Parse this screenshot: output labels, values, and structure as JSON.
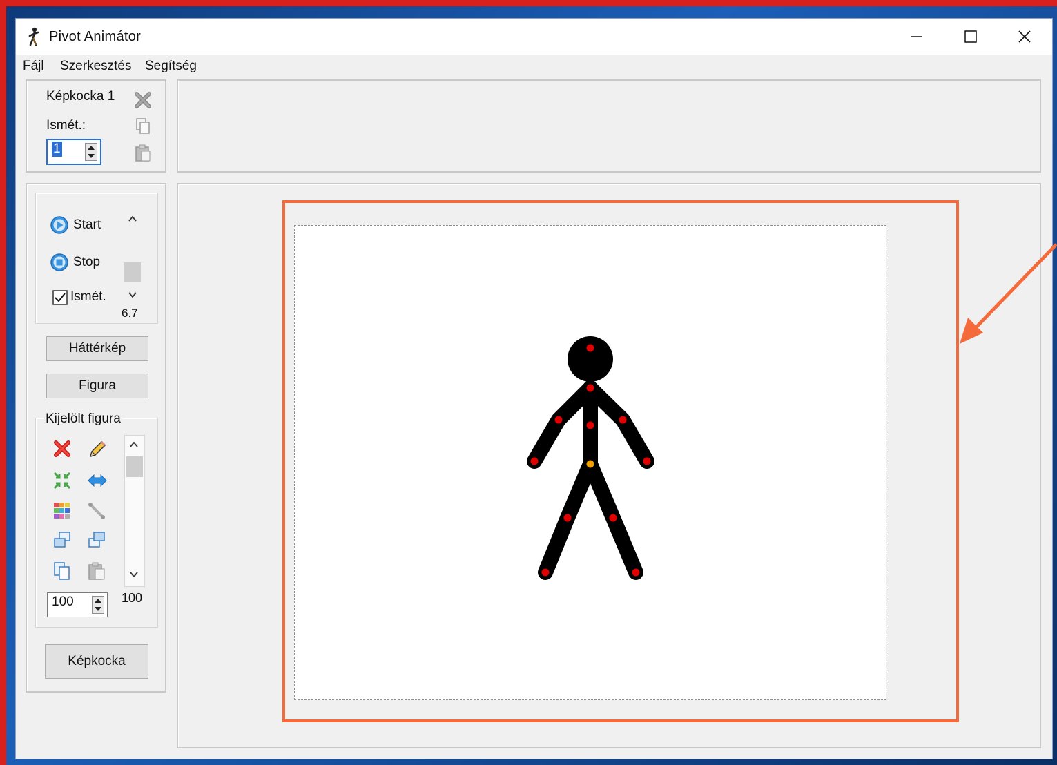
{
  "window": {
    "title": "Pivot Animátor"
  },
  "menu": {
    "file": "Fájl",
    "edit": "Szerkesztés",
    "help": "Segítség"
  },
  "frame": {
    "title": "Képkocka 1",
    "repeat_label": "Ismét.:",
    "repeat_value": "1"
  },
  "playback": {
    "start": "Start",
    "stop": "Stop",
    "loop_label": "Ismét.",
    "loop_checked": true,
    "speed": "6.7"
  },
  "buttons": {
    "background": "Háttérkép",
    "figure": "Figura",
    "frame": "Képkocka"
  },
  "selected_figure": {
    "title": "Kijelölt figura",
    "size_value": "100",
    "scroll_value": "100"
  },
  "colors": {
    "highlight": "#f46a3a",
    "joint": "#e00000",
    "center_joint": "#f0a000"
  }
}
